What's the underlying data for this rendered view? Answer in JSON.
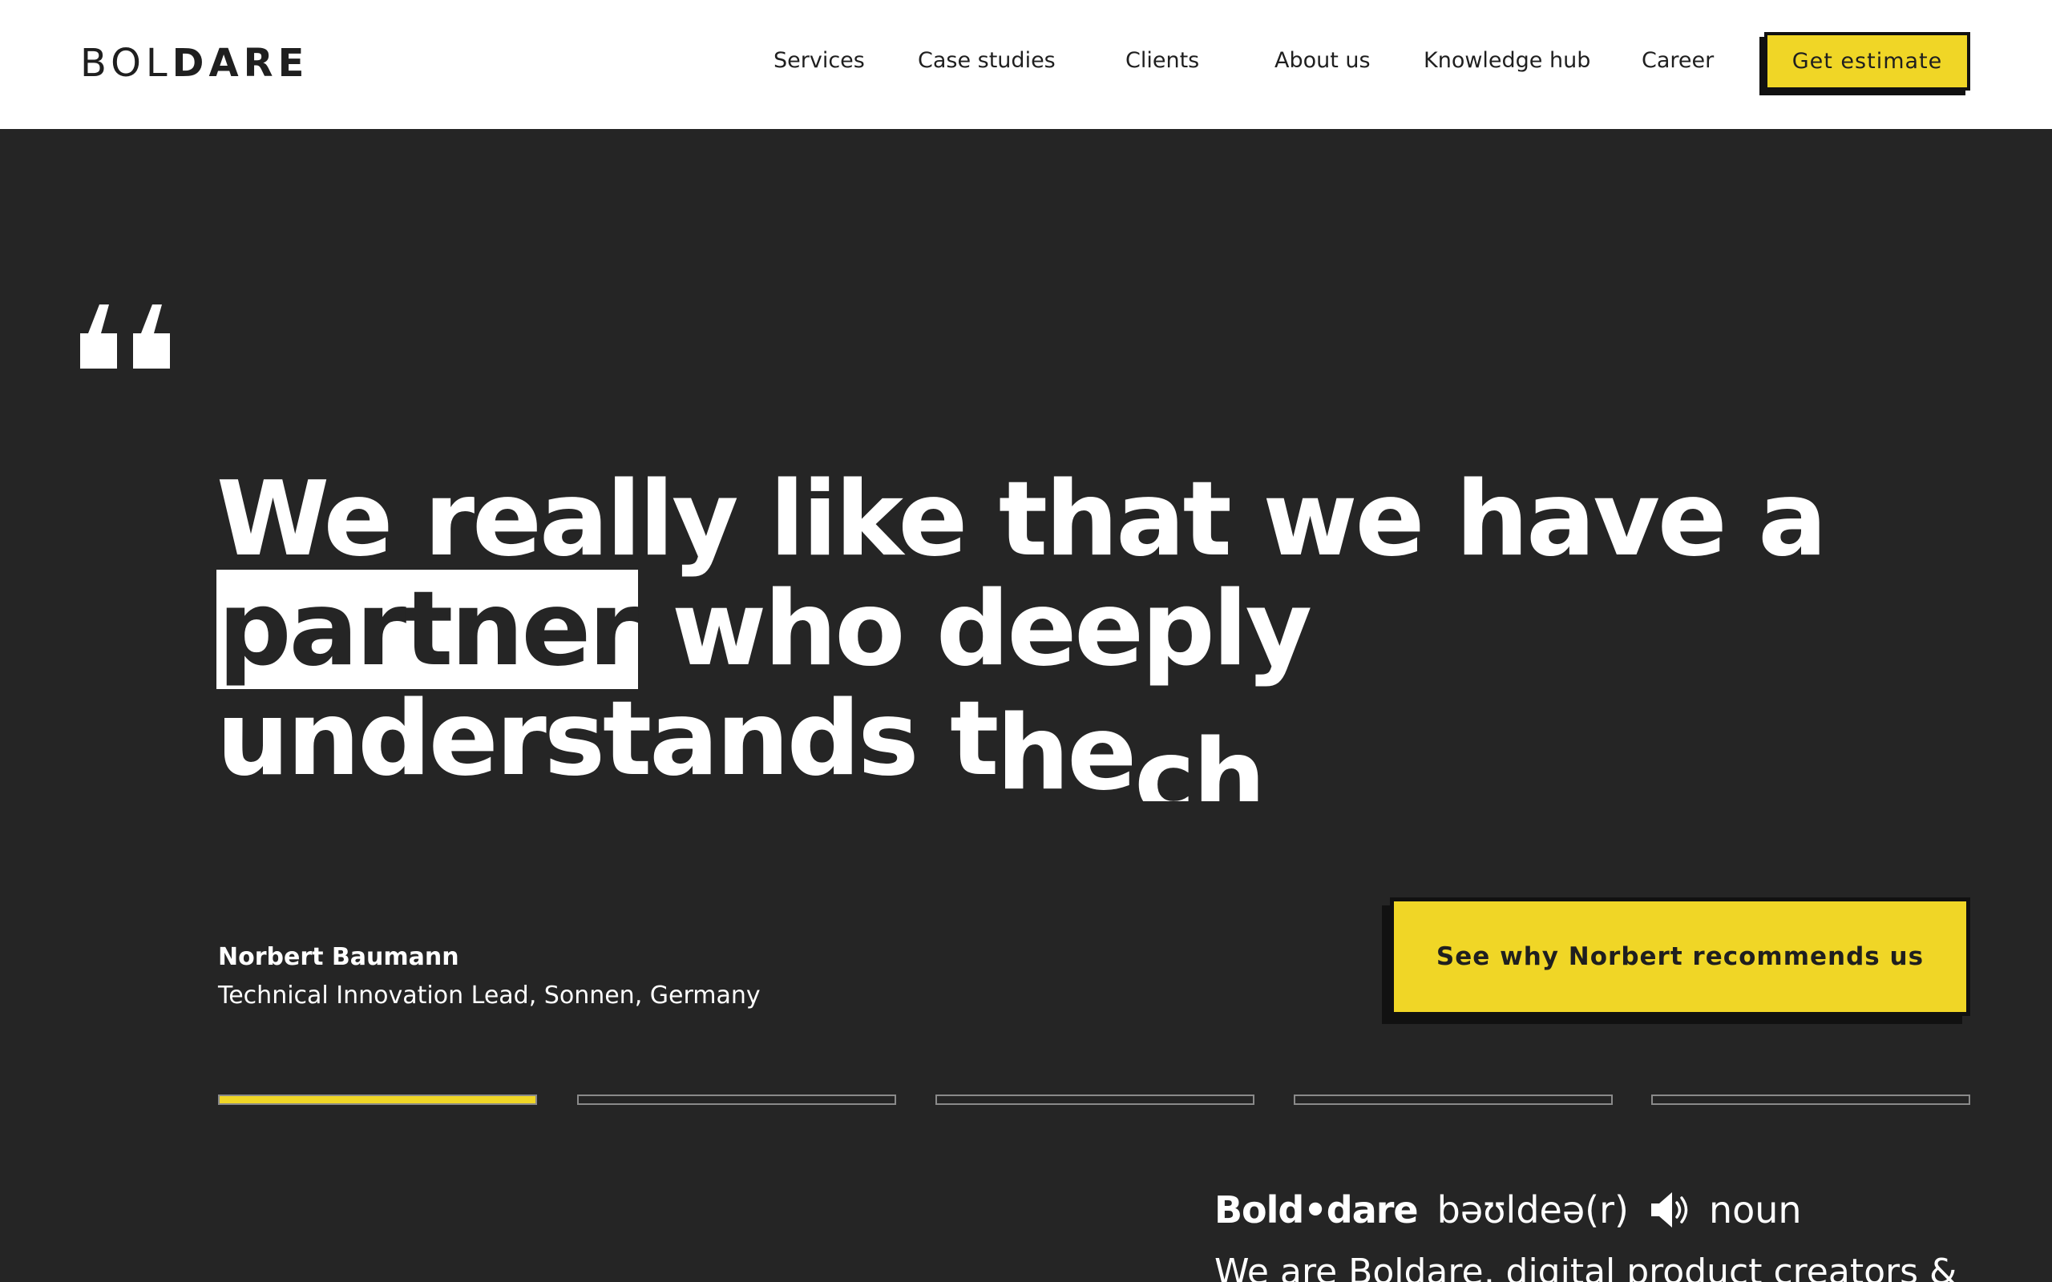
{
  "header": {
    "logo_light": "BOL",
    "logo_heavy": "DARE",
    "nav": {
      "services": "Services",
      "case_studies": "Case studies",
      "clients": "Clients",
      "about_us": "About us",
      "knowledge_hub": "Knowledge hub",
      "career": "Career"
    },
    "cta": "Get estimate"
  },
  "testimonial": {
    "quote_line1": "We really like that we have a",
    "quote_highlight": "partner",
    "quote_line2_rest": " who deeply",
    "quote_line3_a": "understands t",
    "quote_line3_b": "he",
    "quote_line3_c": " ch",
    "author_name": "Norbert Baumann",
    "author_role": "Technical Innovation Lead, Sonnen, Germany",
    "cta": "See why Norbert recommends us",
    "slides_total": 5,
    "active_slide": 1,
    "active_progress": 1.0
  },
  "definition": {
    "word": "Bold•dare",
    "phonetic": "bəʊldeə(r)",
    "speaker_icon": "speaker-icon",
    "part_of_speech": "noun",
    "text": "We are Boldare, digital product creators &"
  },
  "colors": {
    "accent": "#f0d626",
    "background": "#252525",
    "header_bg": "#ffffff",
    "text_dark": "#1f1f1f"
  }
}
